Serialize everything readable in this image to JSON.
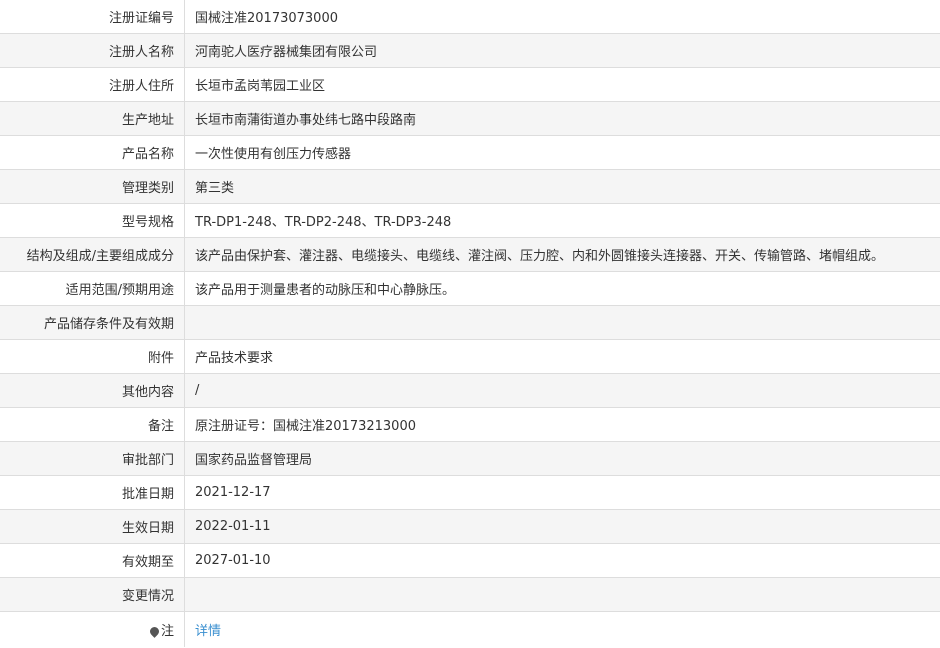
{
  "rows": [
    {
      "label": "注册证编号",
      "value": "国械注准20173073000"
    },
    {
      "label": "注册人名称",
      "value": "河南驼人医疗器械集团有限公司"
    },
    {
      "label": "注册人住所",
      "value": "长垣市孟岗苇园工业区"
    },
    {
      "label": "生产地址",
      "value": "长垣市南蒲街道办事处纬七路中段路南"
    },
    {
      "label": "产品名称",
      "value": "一次性使用有创压力传感器"
    },
    {
      "label": "管理类别",
      "value": "第三类"
    },
    {
      "label": "型号规格",
      "value": "TR-DP1-248、TR-DP2-248、TR-DP3-248"
    },
    {
      "label": "结构及组成/主要组成成分",
      "value": "该产品由保护套、灌注器、电缆接头、电缆线、灌注阀、压力腔、内和外圆锥接头连接器、开关、传输管路、堵帽组成。"
    },
    {
      "label": "适用范围/预期用途",
      "value": "该产品用于测量患者的动脉压和中心静脉压。"
    },
    {
      "label": "产品储存条件及有效期",
      "value": ""
    },
    {
      "label": "附件",
      "value": "产品技术要求"
    },
    {
      "label": "其他内容",
      "value": "/"
    },
    {
      "label": "备注",
      "value": "原注册证号：国械注准20173213000"
    },
    {
      "label": "审批部门",
      "value": "国家药品监督管理局"
    },
    {
      "label": "批准日期",
      "value": "2021-12-17"
    },
    {
      "label": "生效日期",
      "value": "2022-01-11"
    },
    {
      "label": "有效期至",
      "value": "2027-01-10"
    },
    {
      "label": "变更情况",
      "value": ""
    }
  ],
  "note": {
    "label": "注",
    "link": "详情",
    "icon": "pin-icon"
  },
  "colors": {
    "link": "#3a8fd0",
    "border": "#dddddd",
    "stripe": "#f5f5f5"
  }
}
